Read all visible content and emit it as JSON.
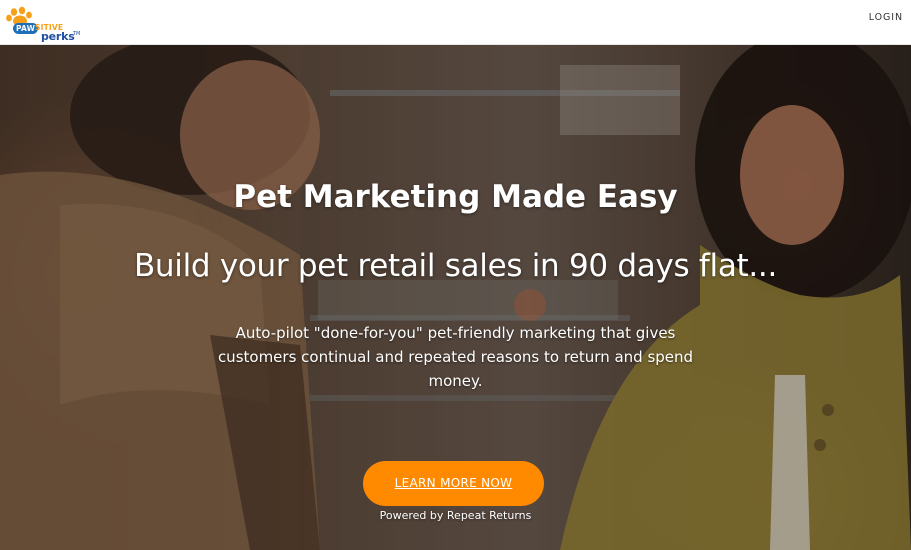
{
  "header": {
    "logo": {
      "word1": "PAW",
      "word1b": "SITIVE",
      "word2": "perks",
      "tm": "TM"
    },
    "login_label": "LOGIN"
  },
  "hero": {
    "title": "Pet Marketing Made Easy",
    "subtitle": "Build your pet retail sales in 90 days flat...",
    "body": "Auto-pilot \"done-for-you\" pet-friendly marketing that gives customers continual and repeated reasons to return and spend money.",
    "cta_label": "LEARN MORE NOW",
    "powered_prefix": "Powered by",
    "powered_link": "Repeat Returns"
  },
  "colors": {
    "cta": "#ff8a00",
    "logo_blue": "#1f6fb8",
    "logo_orange": "#f6a01a"
  }
}
